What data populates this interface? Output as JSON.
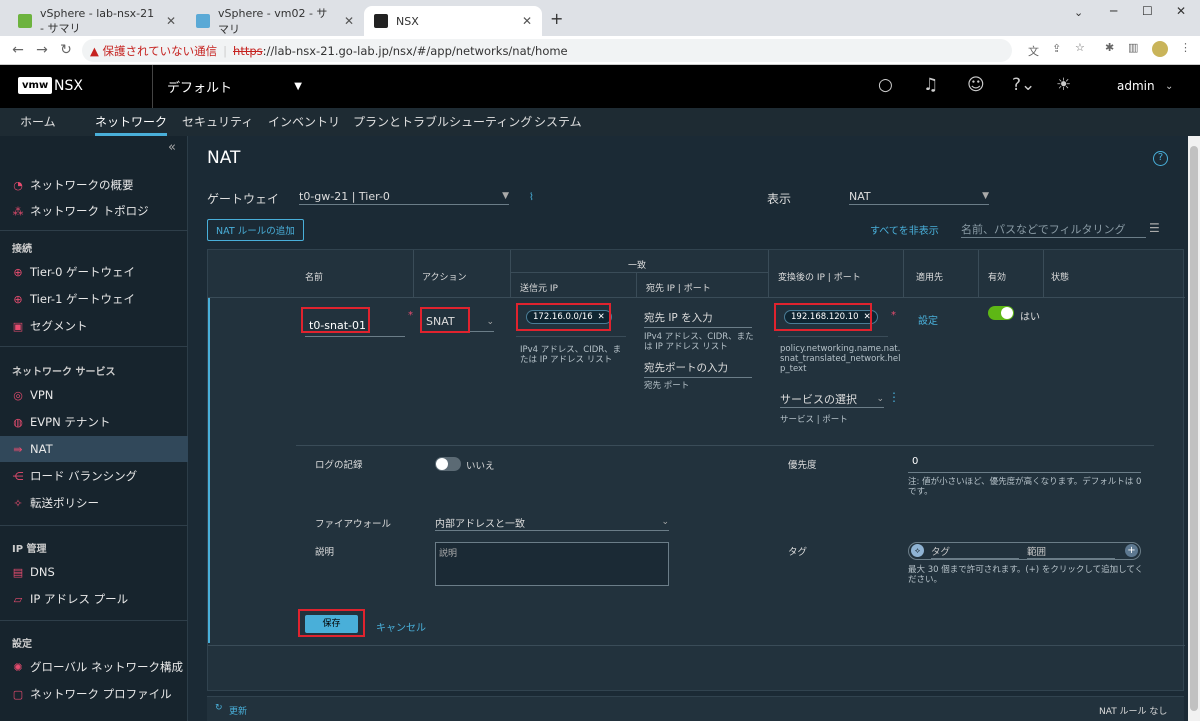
{
  "browser": {
    "tabs": [
      {
        "title": "vSphere - lab-nsx-21 - サマリ",
        "favicon_color": "#6db33f"
      },
      {
        "title": "vSphere - vm02 - サマリ",
        "favicon_color": "#5aa9d6"
      },
      {
        "title": "NSX",
        "favicon_color": "#222"
      }
    ],
    "new_tab": "+",
    "address": {
      "warning": "保護されていない通信",
      "url_https": "https",
      "url_rest": "://lab-nsx-21.go-lab.jp/nsx/#/app/networks/nat/home"
    }
  },
  "header": {
    "logo": "vmw",
    "product": "NSX",
    "project": "デフォルト",
    "user": "admin"
  },
  "topnav": [
    "ホーム",
    "ネットワーク",
    "セキュリティ",
    "インベントリ",
    "プランとトラブルシューティング",
    "システム"
  ],
  "sidebar": {
    "collapse": "«",
    "items_top": [
      "ネットワークの概要",
      "ネットワーク トポロジ"
    ],
    "section_connect": "接続",
    "items_connect": [
      "Tier-0 ゲートウェイ",
      "Tier-1 ゲートウェイ",
      "セグメント"
    ],
    "section_services": "ネットワーク サービス",
    "items_services": [
      "VPN",
      "EVPN テナント",
      "NAT",
      "ロード バランシング",
      "転送ポリシー"
    ],
    "section_ip": "IP 管理",
    "items_ip": [
      "DNS",
      "IP アドレス プール"
    ],
    "section_settings": "設定",
    "items_settings": [
      "グローバル ネットワーク構成",
      "ネットワーク プロファイル"
    ]
  },
  "page": {
    "title": "NAT",
    "help": "?",
    "gateway_label": "ゲートウェイ",
    "gateway_value": "t0-gw-21 | Tier-0",
    "view_label": "表示",
    "view_value": "NAT",
    "add_button": "NAT ルールの追加",
    "collapse_all": "すべてを非表示",
    "filter_placeholder": "名前、パスなどでフィルタリング"
  },
  "table": {
    "headers": {
      "name": "名前",
      "action": "アクション",
      "match": "一致",
      "source_ip": "送信元 IP",
      "dest": "宛先 IP | ポート",
      "translated": "変換後の IP | ポート",
      "apply_to": "適用先",
      "enabled": "有効",
      "status": "状態"
    },
    "row": {
      "name": "t0-snat-01",
      "action": "SNAT",
      "source_chip": "172.16.0.0/16",
      "source_help": "IPv4 アドレス、CIDR、または IP アドレス リスト",
      "dest_ip_placeholder": "宛先 IP を入力",
      "dest_ip_help": "IPv4 アドレス、CIDR、または IP アドレス リスト",
      "dest_port_placeholder": "宛先ポートの入力",
      "dest_port_help": "宛先 ポート",
      "translated_chip": "192.168.120.10",
      "translated_help": "policy.networking.name.nat.snat_translated_network.help_text",
      "service_select": "サービスの選択",
      "service_help": "サービス | ポート",
      "apply_link": "設定",
      "enabled_text": "はい"
    },
    "details": {
      "log_label": "ログの記録",
      "log_value": "いいえ",
      "priority_label": "優先度",
      "priority_value": "0",
      "priority_help": "注: 値が小さいほど、優先度が高くなります。デフォルトは 0 です。",
      "firewall_label": "ファイアウォール",
      "firewall_value": "内部アドレスと一致",
      "desc_label": "説明",
      "desc_placeholder": "説明",
      "tag_label": "タグ",
      "tag_placeholder": "タグ",
      "scope_placeholder": "範囲",
      "tag_help": "最大 30 個まで許可されます。(+) をクリックして追加してください。"
    },
    "save": "保存",
    "cancel": "キャンセル"
  },
  "footer": {
    "refresh": "更新",
    "count": "NAT ルール なし"
  },
  "colors": {
    "accent": "#49afd9",
    "highlight_box": "#e0232e",
    "toggle_on": "#5eb715"
  }
}
